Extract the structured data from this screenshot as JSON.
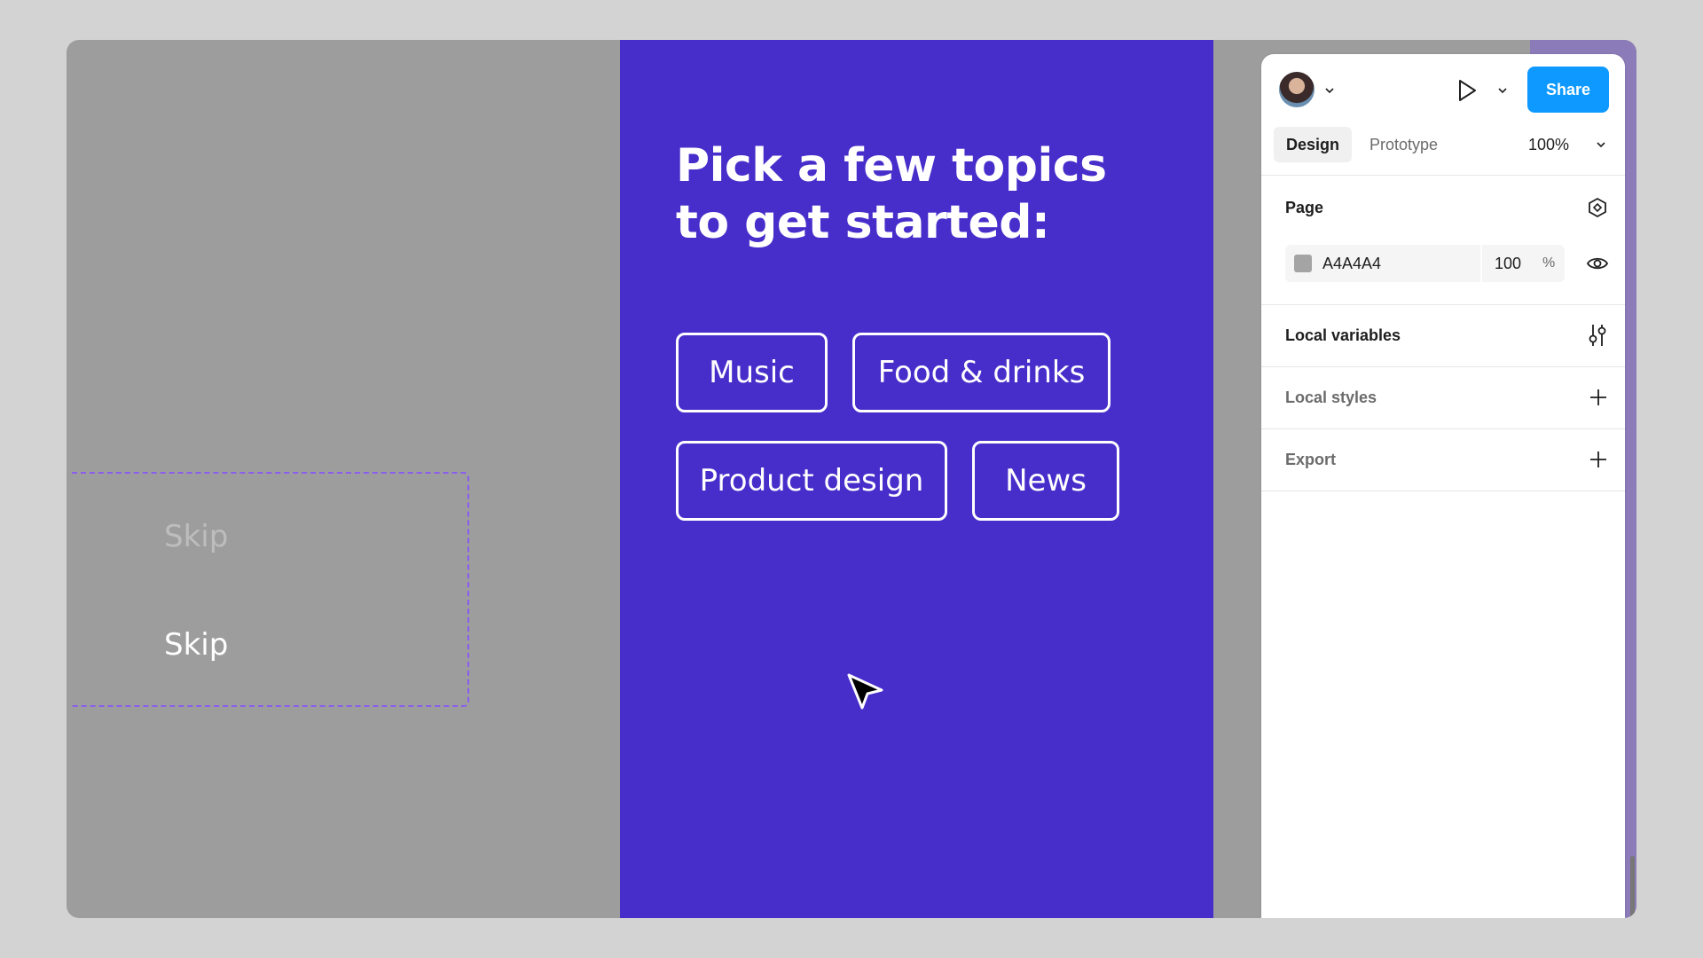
{
  "canvas": {
    "skip_labels": [
      "Skip",
      "Skip"
    ],
    "frame": {
      "title_line1": "Pick a few topics",
      "title_line2": "to get started:",
      "topics": [
        "Music",
        "Food & drinks",
        "Product design",
        "News"
      ],
      "background": "#472ecb"
    }
  },
  "panel": {
    "share_label": "Share",
    "tabs": {
      "design": "Design",
      "prototype": "Prototype"
    },
    "zoom": "100%",
    "page": {
      "title": "Page",
      "color_hex": "A4A4A4",
      "opacity": "100",
      "opacity_unit": "%"
    },
    "sections": {
      "local_variables": "Local variables",
      "local_styles": "Local styles",
      "export": "Export"
    }
  },
  "colors": {
    "accent": "#0d99ff",
    "frame": "#472ecb",
    "canvas_bg": "#9d9d9d"
  },
  "icons": [
    "chevron-down-icon",
    "play-icon",
    "component-icon",
    "eye-icon",
    "sliders-icon",
    "plus-icon",
    "cursor-icon"
  ]
}
